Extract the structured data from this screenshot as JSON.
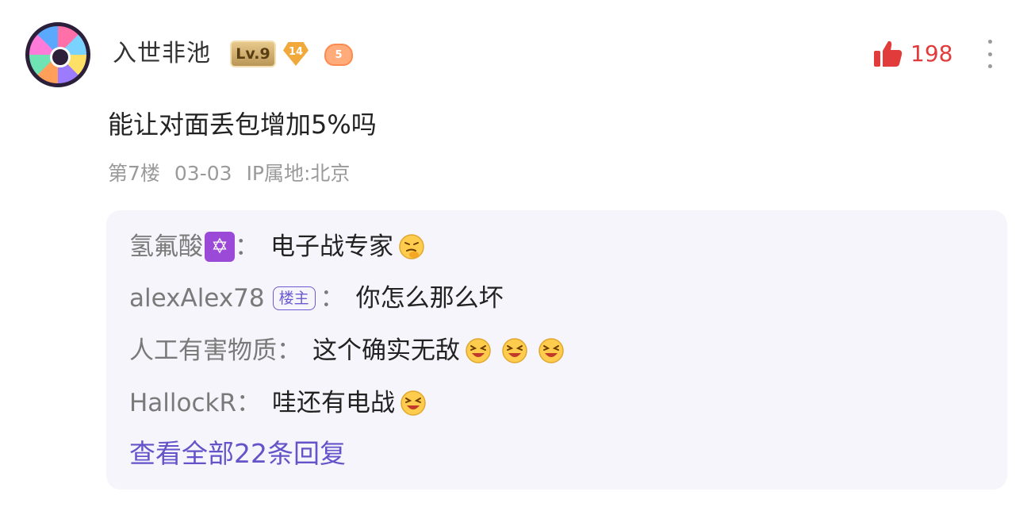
{
  "comment": {
    "username": "入世非池",
    "level_badge": "Lv.9",
    "diamond_badge": "14",
    "game_badge": "5",
    "like_count": "198",
    "text": "能让对面丢包增加5%吗",
    "floor": "第7楼",
    "date": "03-03",
    "ip_location": "IP属地:北京"
  },
  "replies": [
    {
      "name": "氢氟酸",
      "badge_icon": "hexagram-icon",
      "text": "电子战专家",
      "emoji": [
        "thinking-face-icon"
      ]
    },
    {
      "name": "alexAlex78",
      "tag": "楼主",
      "text": "你怎么那么坏"
    },
    {
      "name": "人工有害物质",
      "text": "这个确实无敌",
      "emoji": [
        "grinning-squint-icon",
        "grinning-squint-icon",
        "grinning-squint-icon"
      ]
    },
    {
      "name": "HallockR",
      "text": "哇还有电战",
      "emoji": [
        "grinning-squint-icon"
      ]
    }
  ],
  "colon": "：",
  "view_all_label": "查看全部22条回复",
  "colors": {
    "like": "#e23b3b",
    "link": "#6453c9",
    "reply_bg": "#f5f5fb"
  }
}
